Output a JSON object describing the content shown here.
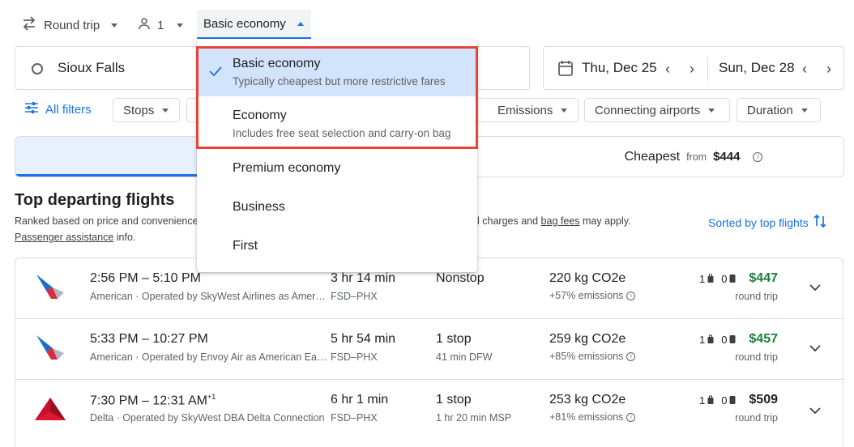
{
  "toolbar": {
    "trip_type": "Round trip",
    "passengers": "1",
    "cabin_class": "Basic economy"
  },
  "search": {
    "origin": "Sioux Falls",
    "depart_date": "Thu, Dec 25",
    "return_date": "Sun, Dec 28"
  },
  "filters": {
    "all_filters": "All filters",
    "stops": "Stops",
    "emissions": "Emissions",
    "connecting_airports": "Connecting airports",
    "duration": "Duration"
  },
  "sort_tabs": {
    "cheapest_label": "Cheapest",
    "from_label": "from",
    "cheapest_price": "$444"
  },
  "results": {
    "heading": "Top departing flights",
    "ranked_text": "Ranked based on price and convenience",
    "charges_text": "l charges and",
    "bag_fees": "bag fees",
    "may_apply": "may apply.",
    "passenger_assistance": "Passenger assistance",
    "info_text": "info.",
    "sorted_by": "Sorted by top flights"
  },
  "dropdown": {
    "options": [
      {
        "title": "Basic economy",
        "subtitle": "Typically cheapest but more restrictive fares",
        "selected": true
      },
      {
        "title": "Economy",
        "subtitle": "Includes free seat selection and carry-on bag",
        "selected": false
      },
      {
        "title": "Premium economy",
        "subtitle": "",
        "selected": false
      },
      {
        "title": "Business",
        "subtitle": "",
        "selected": false
      },
      {
        "title": "First",
        "subtitle": "",
        "selected": false
      }
    ]
  },
  "flights": [
    {
      "times": "2:56 PM – 5:10 PM",
      "times_sup": "",
      "airline": "American · Operated by SkyWest Airlines as Amer…",
      "duration": "3 hr 14 min",
      "route": "FSD–PHX",
      "stops": "Nonstop",
      "stop_detail": "",
      "co2": "220 kg CO2e",
      "emissions_delta": "+57% emissions",
      "bags": "1",
      "carry": "0",
      "price": "$447",
      "price_color": "#188038",
      "price_note": "round trip",
      "logo": "american-airlines-logo-icon"
    },
    {
      "times": "5:33 PM – 10:27 PM",
      "times_sup": "",
      "airline": "American · Operated by Envoy Air as American Ea…",
      "duration": "5 hr 54 min",
      "route": "FSD–PHX",
      "stops": "1 stop",
      "stop_detail": "41 min DFW",
      "co2": "259 kg CO2e",
      "emissions_delta": "+85% emissions",
      "bags": "1",
      "carry": "0",
      "price": "$457",
      "price_color": "#188038",
      "price_note": "round trip",
      "logo": "american-airlines-logo-icon"
    },
    {
      "times": "7:30 PM – 12:31 AM",
      "times_sup": "+1",
      "airline": "Delta · Operated by SkyWest DBA Delta Connection",
      "duration": "6 hr 1 min",
      "route": "FSD–PHX",
      "stops": "1 stop",
      "stop_detail": "1 hr 20 min MSP",
      "co2": "253 kg CO2e",
      "emissions_delta": "+81% emissions",
      "bags": "1",
      "carry": "0",
      "price": "$509",
      "price_color": "#202124",
      "price_note": "round trip",
      "logo": "delta-logo-icon"
    }
  ],
  "colors": {
    "accent": "#1a73e8",
    "selected_bg": "#d2e3fc",
    "highlight_border": "#ea4335",
    "price_green": "#188038"
  }
}
